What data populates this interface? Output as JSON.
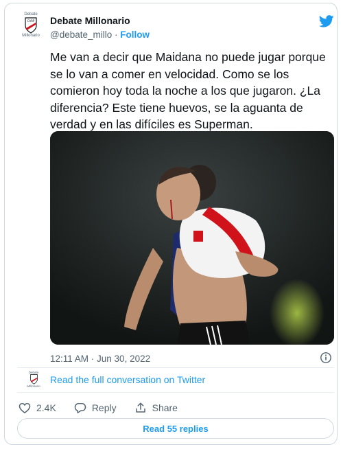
{
  "author": {
    "logo_text_top": "Debate",
    "logo_text_bottom": "Millonario",
    "name": "Debate Millonario",
    "handle": "@debate_millo",
    "separator": "·",
    "follow_label": "Follow"
  },
  "tweet": {
    "text": "Me van a decir que Maidana no puede jugar porque\nse lo van a comer en velocidad. Como se los\ncomieron hoy toda la noche a los que jugaron. ¿La\ndiferencia? Este tiene huevos, se la aguanta de\nverdad y en las difíciles es Superman.",
    "timestamp": "12:11 AM · Jun 30, 2022"
  },
  "conversation": {
    "logo_text_top": "Debate",
    "logo_text_bottom": "Millonario",
    "link_label": "Read the full conversation on Twitter"
  },
  "actions": {
    "likes_count": "2.4K",
    "reply_label": "Reply",
    "share_label": "Share"
  },
  "read_replies_label": "Read 55 replies",
  "icons": {
    "brand": "twitter-bird-icon",
    "info": "info-icon",
    "like": "heart-icon",
    "reply": "reply-bubble-icon",
    "share": "share-icon"
  },
  "colors": {
    "accent": "#1d9bf0",
    "text": "#0f1419",
    "secondary": "#536471",
    "border": "#cfd9de",
    "club_red": "#d0121b"
  }
}
